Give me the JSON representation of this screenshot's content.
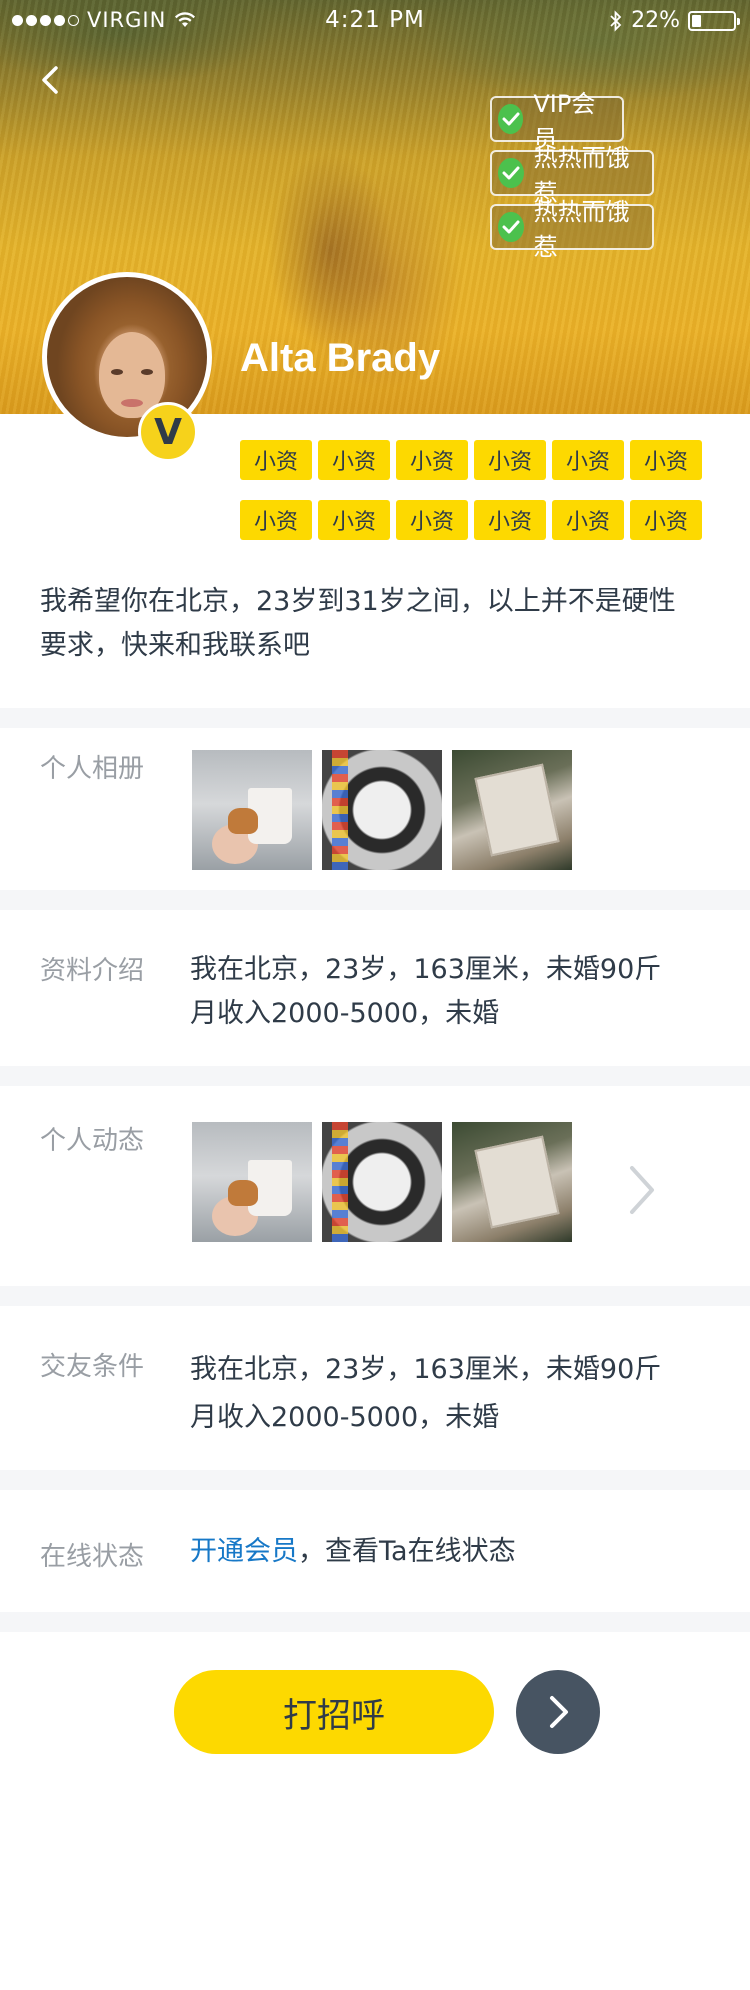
{
  "status_bar": {
    "carrier": "VIRGIN",
    "time": "4:21 PM",
    "battery": "22%",
    "battery_level": 0.22,
    "signal_icon": "signal-dots-icon",
    "wifi_icon": "wifi-icon",
    "bluetooth_icon": "bluetooth-icon"
  },
  "header": {
    "back_icon": "chevron-left-icon",
    "badges": [
      {
        "label": "VIP会员",
        "icon": "check-circle-icon"
      },
      {
        "label": "热热而饿惹",
        "icon": "check-circle-icon"
      },
      {
        "label": "热热而饿惹",
        "icon": "check-circle-icon"
      }
    ]
  },
  "profile": {
    "name": "Alta Brady",
    "verified_mark": "V",
    "tags": [
      "小资",
      "小资",
      "小资",
      "小资",
      "小资",
      "小资",
      "小资",
      "小资",
      "小资",
      "小资",
      "小资",
      "小资"
    ],
    "intro": "我希望你在北京，23岁到31岁之间，以上并不是硬性要求，快来和我联系吧"
  },
  "sections": {
    "album": {
      "label": "个人相册"
    },
    "info": {
      "label": "资料介绍",
      "line1": "我在北京，23岁，163厘米，未婚90斤",
      "line2": "月收入2000-5000，未婚"
    },
    "moments": {
      "label": "个人动态",
      "more_icon": "chevron-right-icon"
    },
    "criteria": {
      "label": "交友条件",
      "line1": "我在北京，23岁，163厘米，未婚90斤",
      "line2": "月收入2000-5000，未婚"
    },
    "online": {
      "label": "在线状态",
      "link": "开通会员",
      "text": "，查看Ta在线状态"
    }
  },
  "actions": {
    "greet": "打招呼",
    "next_icon": "chevron-right-icon"
  },
  "colors": {
    "accent_yellow": "#FDD900",
    "link_blue": "#1778C7",
    "dark_button": "#475462",
    "divider": "#F5F6F8"
  }
}
